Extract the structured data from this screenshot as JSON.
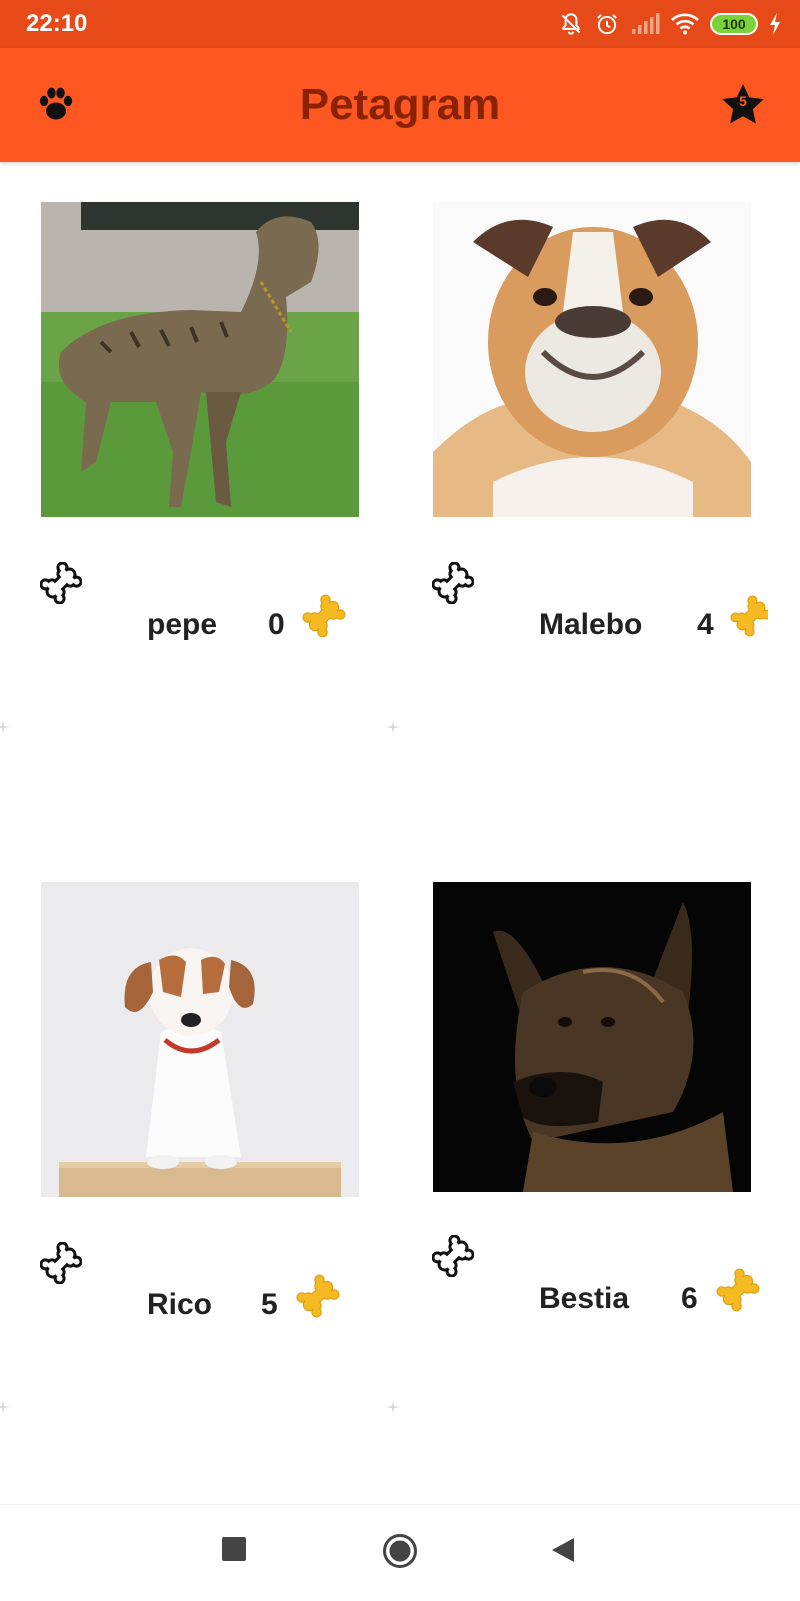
{
  "status_bar": {
    "time": "22:10",
    "battery": "100"
  },
  "app_bar": {
    "title": "Petagram",
    "favorites_count": "5"
  },
  "pets": [
    {
      "name": "pepe",
      "likes": "0",
      "photo": "brindle-dog"
    },
    {
      "name": "Malebo",
      "likes": "4",
      "photo": "bulldog"
    },
    {
      "name": "Rico",
      "likes": "5",
      "photo": "jack-russell-puppy"
    },
    {
      "name": "Bestia",
      "likes": "6",
      "photo": "german-shepherd"
    }
  ],
  "colors": {
    "status_bar": "#e64a19",
    "app_bar": "#ff5722",
    "title_text": "#8a2306",
    "bone_gold": "#f5b921"
  },
  "icons": {
    "app_bar_left": "paw-icon",
    "app_bar_right": "star-icon",
    "like": "bone-outline-icon",
    "likes_count": "bone-gold-icon",
    "nav_recents": "square-icon",
    "nav_home": "circle-icon",
    "nav_back": "triangle-back-icon"
  }
}
